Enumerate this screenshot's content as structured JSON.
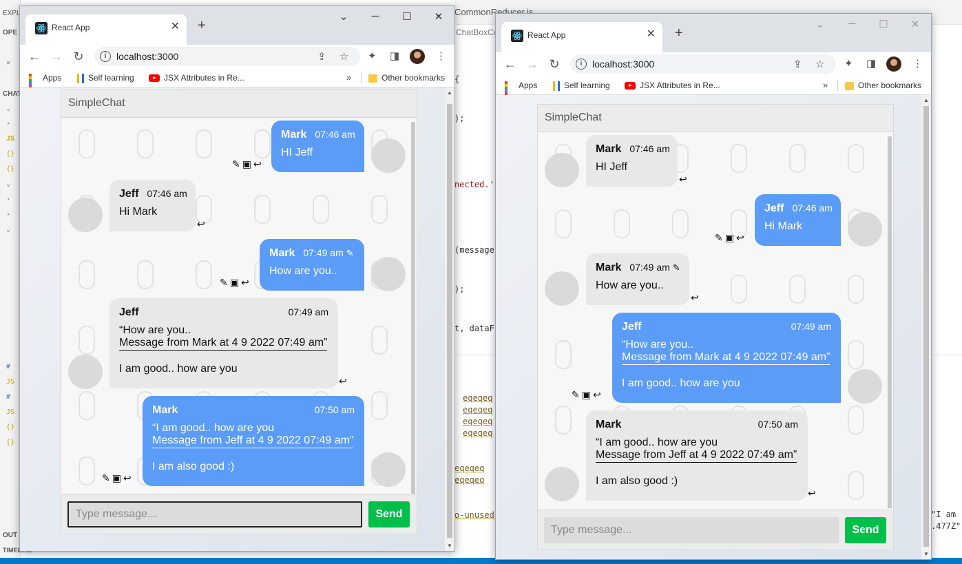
{
  "vscode": {
    "sidebar": {
      "explorer_label": "EXPL",
      "open_editors_label": "OPE",
      "chat_section_label": "CHAT",
      "outline_label": "OUT",
      "timeline_label": "TIMELINE"
    },
    "editor_tab": "CommonReducer.js",
    "breadcrumb": "ChatBoxCo",
    "code_lines": [
      "{",
      ");",
      "nected.'",
      "(message",
      ");",
      "t, dataF"
    ],
    "terminal_links": [
      "eqeqeq",
      "eqeqeq",
      "eqeqeq",
      "eqeqeq",
      "eqeqeq",
      "eqeqeq",
      "o-unused-"
    ],
    "terminal_right": [
      "\"I am",
      ".477Z\""
    ]
  },
  "browsers": [
    {
      "tab_title": "React App",
      "url": "localhost:3000",
      "bookmarks": [
        "Apps",
        "Self learning",
        "JSX Attributes in Re...",
        "Other bookmarks"
      ],
      "chat": {
        "title": "SimpleChat",
        "input_placeholder": "Type message...",
        "send_label": "Send",
        "messages": [
          {
            "sender": "Mark",
            "time": "07:46 am",
            "text": "HI Jeff",
            "mine": true
          },
          {
            "sender": "Jeff",
            "time": "07:46 am",
            "text": "Hi Mark",
            "mine": false
          },
          {
            "sender": "Mark",
            "time": "07:49 am",
            "text": "How are you..",
            "mine": true,
            "edited": true
          },
          {
            "sender": "Jeff",
            "time": "07:49 am",
            "quote_line1": "“How are you..",
            "quote_line2": "Message from Mark at 4 9 2022 07:49 am”",
            "text": "I am good.. how are you",
            "mine": false
          },
          {
            "sender": "Mark",
            "time": "07:50 am",
            "quote_line1": "“I am good.. how are you",
            "quote_line2": "Message from Jeff at 4 9 2022 07:49 am”",
            "text": "I am also good :)",
            "mine": true
          }
        ]
      }
    },
    {
      "tab_title": "React App",
      "url": "localhost:3000",
      "bookmarks": [
        "Apps",
        "Self learning",
        "JSX Attributes in Re...",
        "Other bookmarks"
      ],
      "chat": {
        "title": "SimpleChat",
        "input_placeholder": "Type message...",
        "send_label": "Send",
        "messages": [
          {
            "sender": "Mark",
            "time": "07:46 am",
            "text": "HI Jeff",
            "mine": false
          },
          {
            "sender": "Jeff",
            "time": "07:46 am",
            "text": "Hi Mark",
            "mine": true
          },
          {
            "sender": "Mark",
            "time": "07:49 am",
            "text": "How are you..",
            "mine": false,
            "edited": true
          },
          {
            "sender": "Jeff",
            "time": "07:49 am",
            "quote_line1": "“How are you..",
            "quote_line2": "Message from Mark at 4 9 2022 07:49 am”",
            "text": "I am good.. how are you",
            "mine": true
          },
          {
            "sender": "Mark",
            "time": "07:50 am",
            "quote_line1": "“I am good.. how are you",
            "quote_line2": "Message from Jeff at 4 9 2022 07:49 am”",
            "text": "I am also good :)",
            "mine": false
          }
        ]
      }
    }
  ],
  "icons": {
    "edit": "pencil-icon",
    "delete": "archive-icon",
    "reply": "reply-icon",
    "edited": "pencil-outline-icon"
  },
  "colors": {
    "my_bubble": "#5b9cf8",
    "their_bubble": "#e8e8e8",
    "send_button": "#00c04b",
    "avatar_placeholder": "#dadada"
  }
}
